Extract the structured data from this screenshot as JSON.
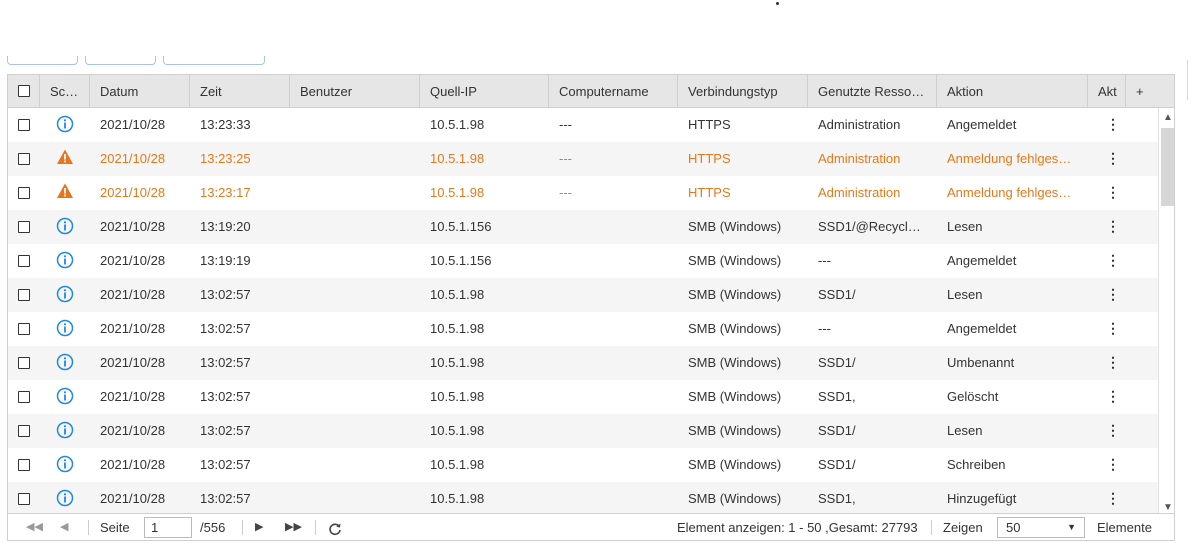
{
  "header": {
    "select_all_label": "",
    "columns": [
      "Sc…",
      "Datum",
      "Zeit",
      "Benutzer",
      "Quell-IP",
      "Computername",
      "Verbindungstyp",
      "Genutzte Resso…",
      "Aktion",
      "Akt",
      "+"
    ]
  },
  "rows": [
    {
      "severity": "info",
      "date": "2021/10/28",
      "time": "13:23:33",
      "user": "",
      "ip": "10.5.1.98",
      "computer": "---",
      "conn": "HTTPS",
      "resource": "Administration",
      "action": "Angemeldet"
    },
    {
      "severity": "warning",
      "date": "2021/10/28",
      "time": "13:23:25",
      "user": "",
      "ip": "10.5.1.98",
      "computer": "---",
      "conn": "HTTPS",
      "resource": "Administration",
      "action": "Anmeldung fehlges…"
    },
    {
      "severity": "warning",
      "date": "2021/10/28",
      "time": "13:23:17",
      "user": "",
      "ip": "10.5.1.98",
      "computer": "---",
      "conn": "HTTPS",
      "resource": "Administration",
      "action": "Anmeldung fehlges…"
    },
    {
      "severity": "info",
      "date": "2021/10/28",
      "time": "13:19:20",
      "user": "",
      "ip": "10.5.1.156",
      "computer": "",
      "conn": "SMB (Windows)",
      "resource": "SSD1/@Recycl…",
      "action": "Lesen"
    },
    {
      "severity": "info",
      "date": "2021/10/28",
      "time": "13:19:19",
      "user": "",
      "ip": "10.5.1.156",
      "computer": "",
      "conn": "SMB (Windows)",
      "resource": "---",
      "action": "Angemeldet"
    },
    {
      "severity": "info",
      "date": "2021/10/28",
      "time": "13:02:57",
      "user": "",
      "ip": "10.5.1.98",
      "computer": "",
      "conn": "SMB (Windows)",
      "resource": "SSD1/",
      "action": "Lesen"
    },
    {
      "severity": "info",
      "date": "2021/10/28",
      "time": "13:02:57",
      "user": "",
      "ip": "10.5.1.98",
      "computer": "",
      "conn": "SMB (Windows)",
      "resource": "---",
      "action": "Angemeldet"
    },
    {
      "severity": "info",
      "date": "2021/10/28",
      "time": "13:02:57",
      "user": "",
      "ip": "10.5.1.98",
      "computer": "",
      "conn": "SMB (Windows)",
      "resource": "SSD1/",
      "action": "Umbenannt"
    },
    {
      "severity": "info",
      "date": "2021/10/28",
      "time": "13:02:57",
      "user": "",
      "ip": "10.5.1.98",
      "computer": "",
      "conn": "SMB (Windows)",
      "resource": "SSD1,",
      "action": "Gelöscht"
    },
    {
      "severity": "info",
      "date": "2021/10/28",
      "time": "13:02:57",
      "user": "",
      "ip": "10.5.1.98",
      "computer": "",
      "conn": "SMB (Windows)",
      "resource": "SSD1/",
      "action": "Lesen"
    },
    {
      "severity": "info",
      "date": "2021/10/28",
      "time": "13:02:57",
      "user": "",
      "ip": "10.5.1.98",
      "computer": "",
      "conn": "SMB (Windows)",
      "resource": "SSD1/",
      "action": "Schreiben"
    },
    {
      "severity": "info",
      "date": "2021/10/28",
      "time": "13:02:57",
      "user": "",
      "ip": "10.5.1.98",
      "computer": "",
      "conn": "SMB (Windows)",
      "resource": "SSD1,",
      "action": "Hinzugefügt"
    }
  ],
  "row_action_icon": "kebab-menu-icon",
  "pager": {
    "page_label": "Seite",
    "page_value": "1",
    "total_pages": "/556",
    "summary": "Element anzeigen: 1 - 50 ,Gesamt: 27793",
    "show_label": "Zeigen",
    "page_size": "50",
    "items_label": "Elemente"
  },
  "colors": {
    "warning_text": "#e07a1f",
    "info_icon": "#1e88e5",
    "header_bg": "#e6e6e6"
  }
}
